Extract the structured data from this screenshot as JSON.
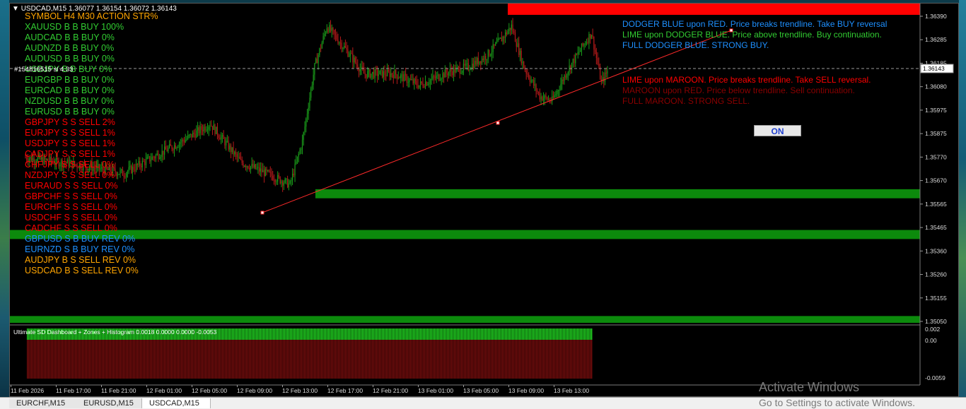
{
  "window": {
    "title": "USDCAD,M15",
    "ohlc": "1.36077 1.36154 1.36072 1.36143",
    "menu_icon": "triangle-down-icon"
  },
  "colors": {
    "background": "#000000",
    "bull": "#1a9c1a",
    "bear": "#b51a1a",
    "zone_green": "#0c8a0c",
    "zone_red": "#ff0000",
    "trendline": "#ff2a2a",
    "bid_line": "#9a9a9a",
    "dodger": "#1e90ff",
    "lime": "#32cd32",
    "maroon": "#8b0000",
    "orange": "#ffa500",
    "red_text": "#ff0000"
  },
  "dashboard": {
    "header": "SYMBOL H4 M30 ACTION STR%",
    "rows": [
      {
        "text": "XAUUSD B B BUY 100%",
        "color": "#32cd32"
      },
      {
        "text": "AUDCAD B B BUY 0%",
        "color": "#32cd32"
      },
      {
        "text": "AUDNZD B B BUY 0%",
        "color": "#32cd32"
      },
      {
        "text": "AUDUSD B B BUY 0%",
        "color": "#32cd32"
      },
      {
        "text": "USDJPY B B BUY 0%",
        "color": "#32cd32"
      },
      {
        "text": "EURGBP B B BUY 0%",
        "color": "#32cd32"
      },
      {
        "text": "EURCAD B B BUY 0%",
        "color": "#32cd32"
      },
      {
        "text": "NZDUSD B B BUY 0%",
        "color": "#32cd32"
      },
      {
        "text": "EURUSD B B BUY 0%",
        "color": "#32cd32"
      },
      {
        "text": "GBPJPY S S SELL 2%",
        "color": "#ff0000"
      },
      {
        "text": "EURJPY S S SELL 1%",
        "color": "#ff0000"
      },
      {
        "text": "USDJPY S S SELL 1%",
        "color": "#ff0000"
      },
      {
        "text": "CADJPY S S SELL 1%",
        "color": "#ff0000"
      },
      {
        "text": "CHFJPY S S SELL 0%",
        "color": "#ff0000"
      },
      {
        "text": "NZDJPY S S SELL 0%",
        "color": "#ff0000"
      },
      {
        "text": "EURAUD S S SELL 0%",
        "color": "#ff0000"
      },
      {
        "text": "GBPCHF S S SELL 0%",
        "color": "#ff0000"
      },
      {
        "text": "EURCHF S S SELL 0%",
        "color": "#ff0000"
      },
      {
        "text": "USDCHF S S SELL 0%",
        "color": "#ff0000"
      },
      {
        "text": "CADCHF S S SELL 0%",
        "color": "#ff0000"
      },
      {
        "text": "GBPUSD S B BUY REV 0%",
        "color": "#1e90ff"
      },
      {
        "text": "EURNZD S B BUY REV 0%",
        "color": "#1e90ff"
      },
      {
        "text": "AUDJPY B S SELL REV 0%",
        "color": "#ffa500"
      },
      {
        "text": "USDCAD B S SELL REV 0%",
        "color": "#ffa500"
      }
    ],
    "object_label": "#154816515 sl 4.33"
  },
  "legend": {
    "buy": [
      {
        "text": "DODGER BLUE upon RED. Price breaks trendline. Take BUY reversal",
        "color": "#1e90ff"
      },
      {
        "text": "LIME upon DODGER BLUE. Price above trendline. Buy continuation.",
        "color": "#32cd32"
      },
      {
        "text": "FULL DODGER BLUE. STRONG BUY.",
        "color": "#1e90ff"
      }
    ],
    "sell": [
      {
        "text": "LIME upon MAROON. Price breaks trendline. Take SELL reversal.",
        "color": "#ff0000"
      },
      {
        "text": "MAROON upon RED. Price below trendline. Sell continuation.",
        "color": "#8b0000"
      },
      {
        "text": "FULL MAROON. STRONG SELL.",
        "color": "#8b0000"
      }
    ]
  },
  "on_button": "ON",
  "price_axis": {
    "labels": [
      "1.36390",
      "1.36285",
      "1.36185",
      "1.36080",
      "1.35975",
      "1.35875",
      "1.35770",
      "1.35670",
      "1.35565",
      "1.35465",
      "1.35360",
      "1.35260",
      "1.35155",
      "1.35050"
    ],
    "bid": "1.36143"
  },
  "indicator": {
    "title": "Ultimate SD Dashboard + Zones + Histogram 0.0018 0.0000 0.0000 -0.0053",
    "axis_labels": [
      "0.002",
      "0.00",
      "-0.0059"
    ]
  },
  "time_axis": [
    "11 Feb 2026",
    "11 Feb 17:00",
    "11 Feb 21:00",
    "12 Feb 01:00",
    "12 Feb 05:00",
    "12 Feb 09:00",
    "12 Feb 13:00",
    "12 Feb 17:00",
    "12 Feb 21:00",
    "13 Feb 01:00",
    "13 Feb 05:00",
    "13 Feb 09:00",
    "13 Feb 13:00"
  ],
  "tabs": [
    {
      "label": "EURCHF,M15",
      "active": false
    },
    {
      "label": "EURUSD,M15",
      "active": false
    },
    {
      "label": "USDCAD,M15",
      "active": true
    }
  ],
  "watermark": {
    "line1": "Activate Windows",
    "line2": "Go to Settings to activate Windows."
  },
  "chart_data": {
    "type": "candlestick",
    "symbol": "USDCAD",
    "timeframe": "M15",
    "ylim": [
      1.3502,
      1.3643
    ],
    "bid": 1.36143,
    "zones": [
      {
        "kind": "supply",
        "color": "red",
        "top": 1.3643,
        "bottom": 1.3638
      },
      {
        "kind": "demand",
        "color": "green",
        "top": 1.3561,
        "bottom": 1.3557
      },
      {
        "kind": "demand",
        "color": "green",
        "top": 1.3543,
        "bottom": 1.3539
      },
      {
        "kind": "demand",
        "color": "green",
        "top": 1.3505,
        "bottom": 1.3502
      }
    ],
    "trendline": [
      {
        "bar": 120,
        "price": 1.3552
      },
      {
        "bar": 230,
        "price": 1.359
      },
      {
        "bar": 340,
        "price": 1.3633
      }
    ],
    "histogram": {
      "ylim": [
        -0.0059,
        0.002
      ],
      "top_green": 0.0018,
      "bottom_red": -0.0053
    }
  }
}
